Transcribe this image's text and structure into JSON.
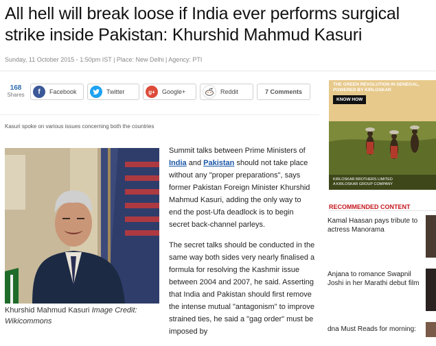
{
  "article": {
    "headline": "All hell will break loose if India ever performs surgical strike inside Pakistan: Khurshid Mahmud Kasuri",
    "meta": "Sunday, 11 October 2015 - 1:50pm IST | Place: New Delhi | Agency: PTI",
    "summary": "Kasuri spoke on various issues concerning both the countries",
    "image_caption_name": "Khurshid Mahmud Kasuri",
    "image_caption_credit": "Image Credit: Wikicommons",
    "body": {
      "p1_a": "Summit talks between Prime Ministers of ",
      "p1_link1": "India",
      "p1_b": " and ",
      "p1_link2": "Pakistan",
      "p1_c": " should not take place without any \"proper preparations\", says former Pakistan Foreign Minister Khurshid Mahmud Kasuri, adding the only way to end the post-Ufa deadlock is to begin secret back-channel parleys.",
      "p2": "The secret talks should be conducted in the same way both sides very nearly finalised a formula for resolving the Kashmir issue between 2004 and 2007, he said. Asserting that India and Pakistan should first remove the intense mutual \"antagonism\" to improve strained ties, he said a \"gag order\" must be imposed by"
    }
  },
  "share": {
    "count": "168",
    "count_label": "Shares",
    "facebook": "Facebook",
    "twitter": "Twitter",
    "googleplus": "Google+",
    "reddit": "Reddit",
    "comments": "7 Comments",
    "colors": {
      "facebook": "#3b5998",
      "twitter": "#1da1f2",
      "googleplus": "#dd4b39",
      "reddit": "#ff4500"
    }
  },
  "ad": {
    "title_line1": "THE GREEN REVOLUTION IN SENEGAL,",
    "title_line2": "POWERED BY KIRLOSKAR",
    "cta": "KNOW HOW",
    "brand_line1": "KIRLOSKAR BROTHERS LIMITED",
    "brand_line2": "A KIRLOSKAR GROUP COMPANY"
  },
  "recommended": {
    "heading": "RECOMMENDED CONTENT",
    "items": [
      {
        "title": "Kamal Haasan pays tribute to actress Manorama"
      },
      {
        "title": "Anjana to romance Swapnil Joshi in her Marathi debut film"
      },
      {
        "title": "dna Must Reads for morning:"
      }
    ],
    "accent_color": "#c4161c"
  }
}
